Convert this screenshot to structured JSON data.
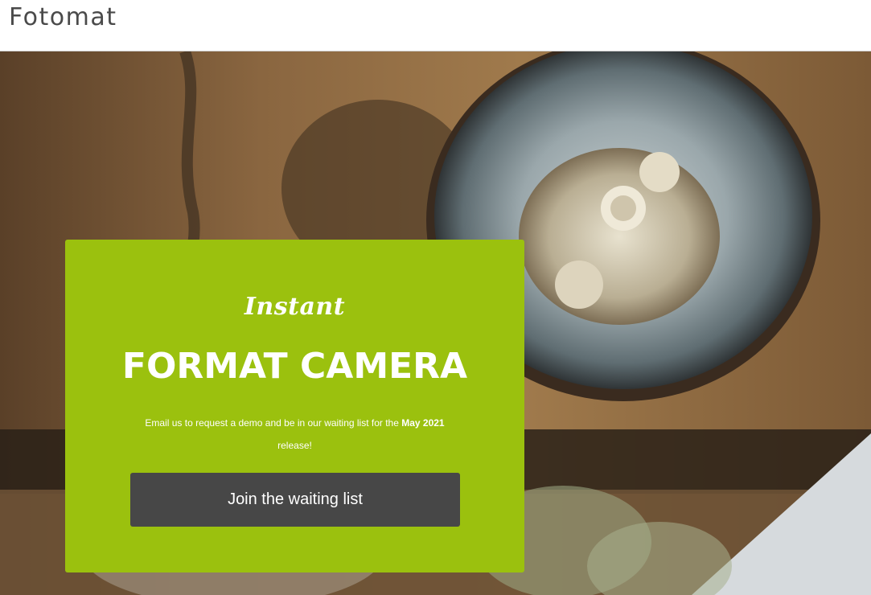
{
  "header": {
    "brand": "Fotomat"
  },
  "hero": {
    "background_image": "overhead photo of a ceramic bowl with crumbled food on a wooden table",
    "card": {
      "eyebrow": "Instant",
      "title": "FORMAT CAMERA",
      "text_before": "Email us to request a demo and be in our waiting list for the ",
      "text_bold": "May 2021",
      "text_after": " release!",
      "cta_label": "Join the waiting list"
    }
  },
  "colors": {
    "card_green": "#9bc10e",
    "button_gray": "#474747",
    "brand_text": "#4a4a4a"
  }
}
